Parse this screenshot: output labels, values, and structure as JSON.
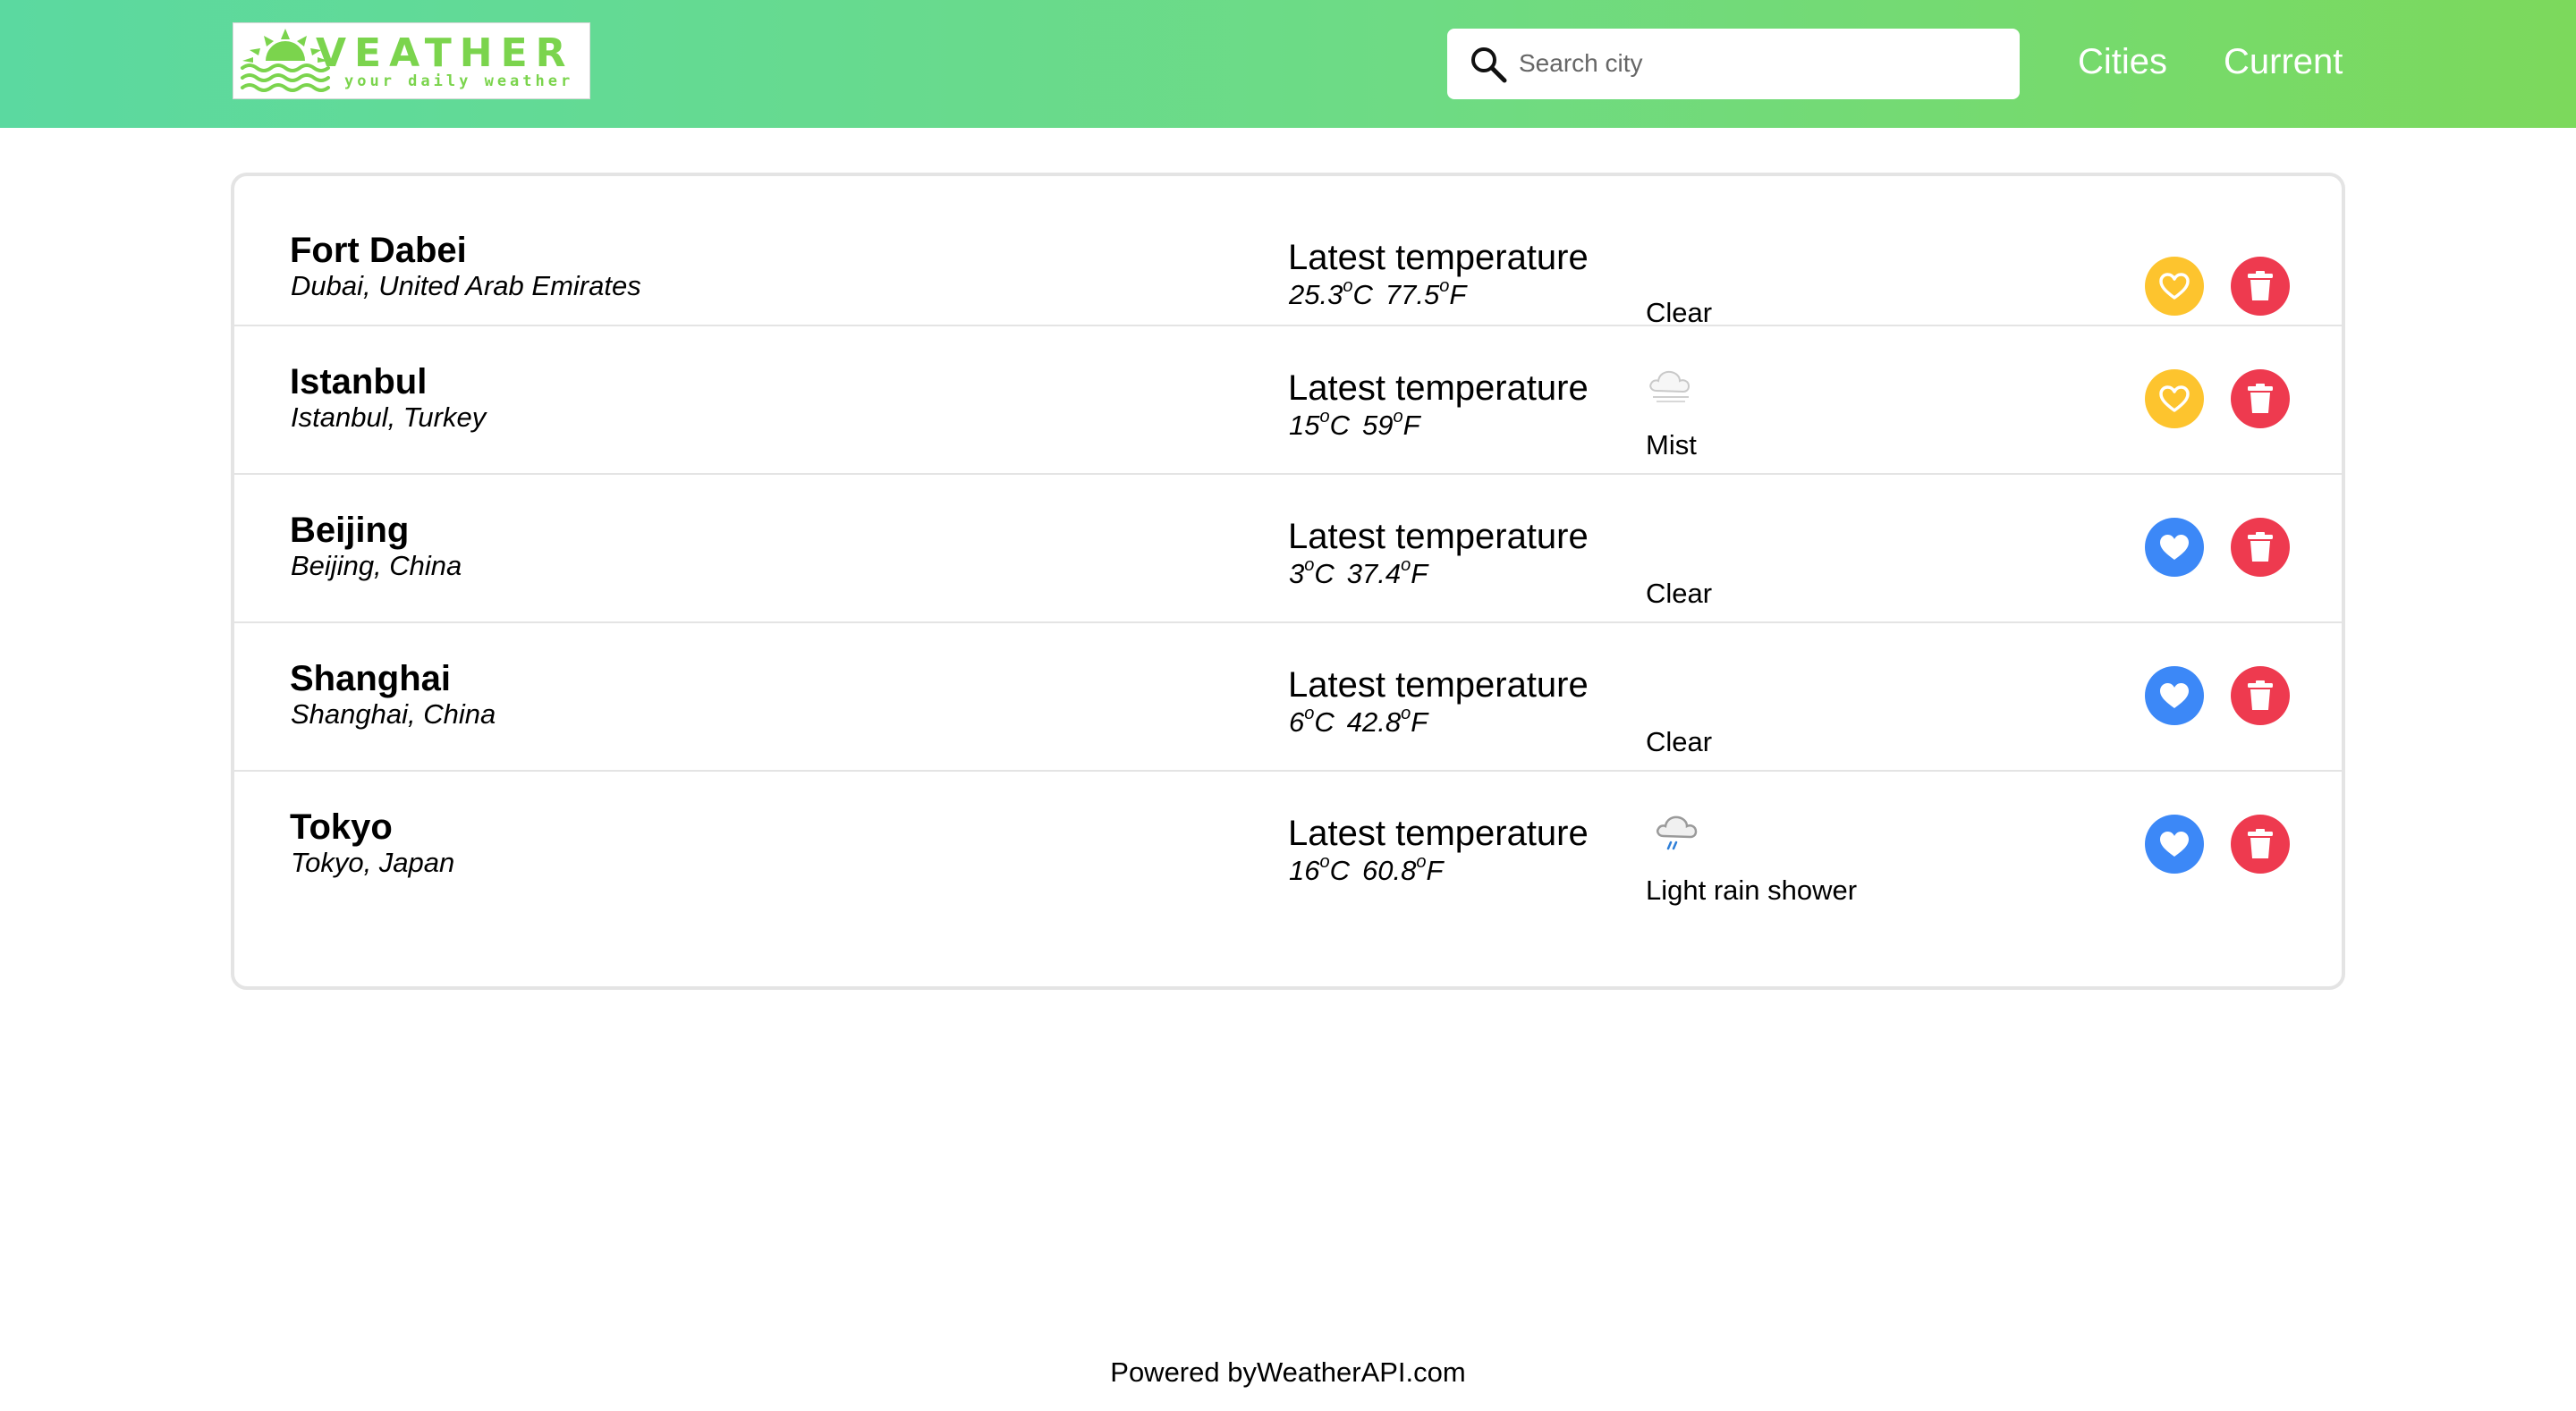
{
  "header": {
    "logo": {
      "title": "VEATHER",
      "tagline": "your daily weather"
    },
    "search": {
      "placeholder": "Search city",
      "value": ""
    },
    "nav": [
      {
        "label": "Cities"
      },
      {
        "label": "Current"
      }
    ]
  },
  "cities": [
    {
      "name": "Fort Dabei",
      "location": "Dubai, United Arab Emirates",
      "temp_label": "Latest temperature",
      "temp_c": "25.3",
      "temp_f": "77.5",
      "unit_c": "C",
      "unit_f": "F",
      "degree_mark": "o",
      "condition": "Clear",
      "condition_icon": "moon-clear-icon",
      "favorite": false,
      "favorite_color": "#fdc42e"
    },
    {
      "name": "Istanbul",
      "location": "Istanbul, Turkey",
      "temp_label": "Latest temperature",
      "temp_c": "15",
      "temp_f": "59",
      "unit_c": "C",
      "unit_f": "F",
      "degree_mark": "o",
      "condition": "Mist",
      "condition_icon": "mist-cloud-icon",
      "favorite": false,
      "favorite_color": "#fdc42e"
    },
    {
      "name": "Beijing",
      "location": "Beijing, China",
      "temp_label": "Latest temperature",
      "temp_c": "3",
      "temp_f": "37.4",
      "unit_c": "C",
      "unit_f": "F",
      "degree_mark": "o",
      "condition": "Clear",
      "condition_icon": "moon-clear-icon",
      "favorite": true,
      "favorite_color": "#3c88f7"
    },
    {
      "name": "Shanghai",
      "location": "Shanghai, China",
      "temp_label": "Latest temperature",
      "temp_c": "6",
      "temp_f": "42.8",
      "unit_c": "C",
      "unit_f": "F",
      "degree_mark": "o",
      "condition": "Clear",
      "condition_icon": "moon-clear-icon",
      "favorite": true,
      "favorite_color": "#3c88f7"
    },
    {
      "name": "Tokyo",
      "location": "Tokyo, Japan",
      "temp_label": "Latest temperature",
      "temp_c": "16",
      "temp_f": "60.8",
      "unit_c": "C",
      "unit_f": "F",
      "degree_mark": "o",
      "condition": "Light rain shower",
      "condition_icon": "moon-rain-cloud-icon",
      "favorite": true,
      "favorite_color": "#3c88f7"
    }
  ],
  "colors": {
    "header_gradient_start": "#5bd9a0",
    "header_gradient_end": "#7cd95c",
    "delete": "#ee3a4f",
    "favorite_off": "#fdc42e",
    "favorite_on": "#3c88f7",
    "moon": "#2f7fd8"
  },
  "footer": {
    "text": "Powered byWeatherAPI.com"
  }
}
